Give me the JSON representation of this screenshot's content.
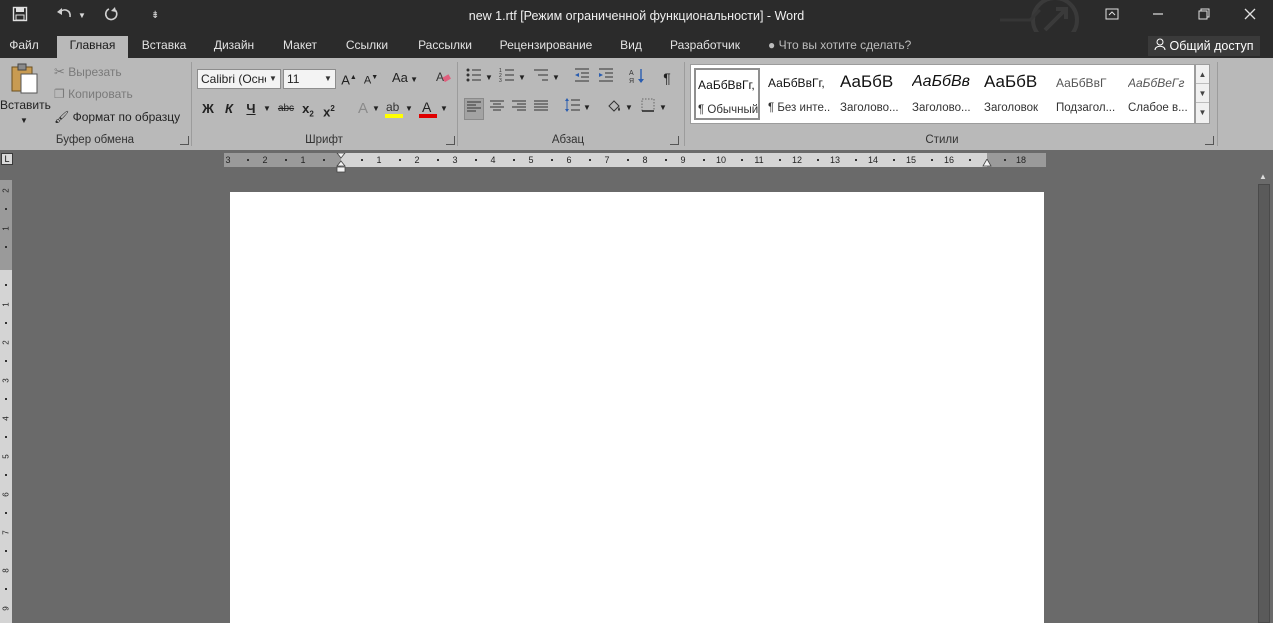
{
  "window": {
    "title": "new 1.rtf [Режим ограниченной функциональности] - Word"
  },
  "tabs": [
    {
      "label": "Файл"
    },
    {
      "label": "Главная"
    },
    {
      "label": "Вставка"
    },
    {
      "label": "Дизайн"
    },
    {
      "label": "Макет"
    },
    {
      "label": "Ссылки"
    },
    {
      "label": "Рассылки"
    },
    {
      "label": "Рецензирование"
    },
    {
      "label": "Вид"
    },
    {
      "label": "Разработчик"
    }
  ],
  "active_tab": "Главная",
  "tell_me": {
    "placeholder": "Что вы хотите сделать?"
  },
  "share": {
    "label": "Общий доступ"
  },
  "clipboard": {
    "group_label": "Буфер обмена",
    "paste_label": "Вставить",
    "cut_label": "Вырезать",
    "copy_label": "Копировать",
    "format_painter_label": "Формат по образцу"
  },
  "font": {
    "group_label": "Шрифт",
    "font_name": "Calibri (Осно",
    "font_size": "11",
    "bold_glyph": "Ж",
    "italic_glyph": "К",
    "underline_glyph": "Ч",
    "strike_glyph": "abc",
    "change_case_glyph": "Aa",
    "highlight_color": "#ffff00",
    "font_color": "#e00000"
  },
  "paragraph": {
    "group_label": "Абзац",
    "pilcrow_glyph": "¶"
  },
  "styles": {
    "group_label": "Стили",
    "items": [
      {
        "sample": "АаБбВвГг,",
        "name": "¶ Обычный",
        "selected": true
      },
      {
        "sample": "АаБбВвГг,",
        "name": "¶ Без инте...",
        "selected": false
      },
      {
        "sample": "АаБбВ",
        "name": "Заголово...",
        "selected": false
      },
      {
        "sample": "АаБбВв",
        "name": "Заголово...",
        "selected": false
      },
      {
        "sample": "АаБбВ",
        "name": "Заголовок",
        "selected": false
      },
      {
        "sample": "АаБбВвГ",
        "name": "Подзагол...",
        "selected": false
      },
      {
        "sample": "АаБбВеГг",
        "name": "Слабое в...",
        "selected": false
      }
    ]
  },
  "ruler": {
    "corner_glyph": "L",
    "horizontal_labels": [
      "3",
      "2",
      "1",
      "1",
      "2",
      "3",
      "4",
      "5",
      "6",
      "7",
      "8",
      "9",
      "10",
      "11",
      "12",
      "13",
      "14",
      "15",
      "16",
      "18"
    ],
    "vertical_labels": [
      "2",
      "1",
      "1",
      "2",
      "3",
      "4",
      "5",
      "6",
      "7",
      "8",
      "9"
    ]
  },
  "colors": {
    "titlebar": "#2b2b2b",
    "ribbon": "#b9b9b9",
    "canvas": "#6a6a6a",
    "page": "#ffffff"
  }
}
